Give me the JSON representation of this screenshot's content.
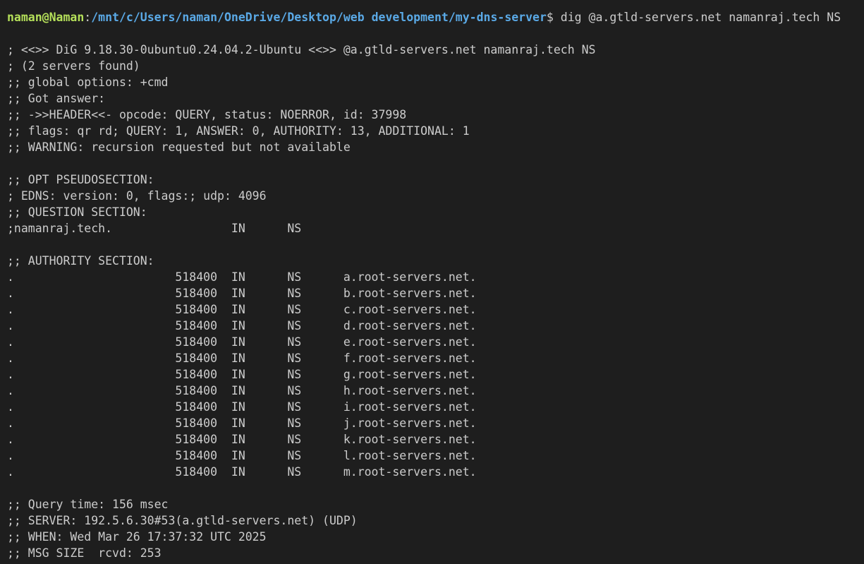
{
  "prompt": {
    "user_host": "naman@Naman",
    "separator": ":",
    "path": "/mnt/c/Users/naman/OneDrive/Desktop/web development/my-dns-server",
    "symbol": "$",
    "command": " dig @a.gtld-servers.net namanraj.tech NS"
  },
  "header_lines": [
    "; <<>> DiG 9.18.30-0ubuntu0.24.04.2-Ubuntu <<>> @a.gtld-servers.net namanraj.tech NS",
    "; (2 servers found)",
    ";; global options: +cmd",
    ";; Got answer:",
    ";; ->>HEADER<<- opcode: QUERY, status: NOERROR, id: 37998",
    ";; flags: qr rd; QUERY: 1, ANSWER: 0, AUTHORITY: 13, ADDITIONAL: 1",
    ";; WARNING: recursion requested but not available"
  ],
  "opt_lines": [
    ";; OPT PSEUDOSECTION:",
    "; EDNS: version: 0, flags:; udp: 4096",
    ";; QUESTION SECTION:",
    ";namanraj.tech.                 IN      NS"
  ],
  "authority_header": ";; AUTHORITY SECTION:",
  "authority_records": [
    ".                       518400  IN      NS      a.root-servers.net.",
    ".                       518400  IN      NS      b.root-servers.net.",
    ".                       518400  IN      NS      c.root-servers.net.",
    ".                       518400  IN      NS      d.root-servers.net.",
    ".                       518400  IN      NS      e.root-servers.net.",
    ".                       518400  IN      NS      f.root-servers.net.",
    ".                       518400  IN      NS      g.root-servers.net.",
    ".                       518400  IN      NS      h.root-servers.net.",
    ".                       518400  IN      NS      i.root-servers.net.",
    ".                       518400  IN      NS      j.root-servers.net.",
    ".                       518400  IN      NS      k.root-servers.net.",
    ".                       518400  IN      NS      l.root-servers.net.",
    ".                       518400  IN      NS      m.root-servers.net."
  ],
  "footer_lines": [
    ";; Query time: 156 msec",
    ";; SERVER: 192.5.6.30#53(a.gtld-servers.net) (UDP)",
    ";; WHEN: Wed Mar 26 17:37:32 UTC 2025",
    ";; MSG SIZE  rcvd: 253"
  ],
  "colors": {
    "background": "#1e1e1e",
    "text": "#cccccc",
    "user_host": "#b5e05a",
    "path": "#5aa9e6"
  }
}
